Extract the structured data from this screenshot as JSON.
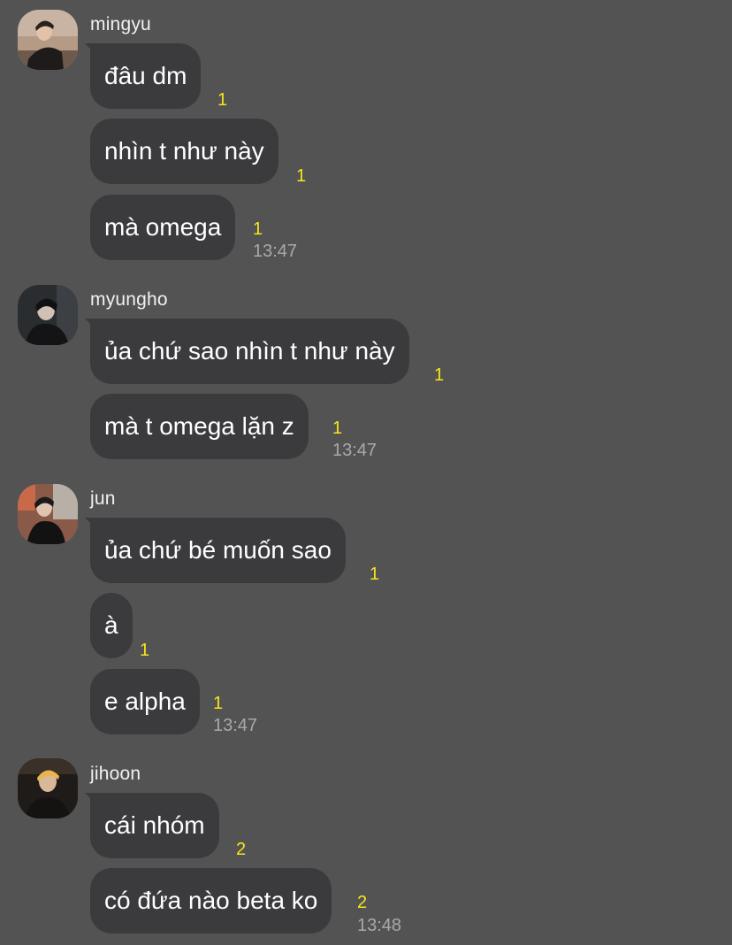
{
  "colors": {
    "background": "#545354",
    "bubble": "#3b3a3d",
    "unread_count": "#f7e51a",
    "timestamp": "#a9a8aa"
  },
  "groups": [
    {
      "sender": "mingyu",
      "avatar_icon": "profile-photo",
      "messages": [
        {
          "text": "đâu dm",
          "unread": "1"
        },
        {
          "text": "nhìn t như này",
          "unread": "1"
        },
        {
          "text": "mà omega",
          "unread": "1"
        }
      ],
      "time": "13:47"
    },
    {
      "sender": "myungho",
      "avatar_icon": "profile-photo",
      "messages": [
        {
          "text": "ủa chứ sao nhìn t như này",
          "unread": "1"
        },
        {
          "text": "mà t omega lặn z",
          "unread": "1"
        }
      ],
      "time": "13:47"
    },
    {
      "sender": "jun",
      "avatar_icon": "profile-photo",
      "messages": [
        {
          "text": "ủa chứ bé muốn sao",
          "unread": "1"
        },
        {
          "text": "à",
          "unread": "1"
        },
        {
          "text": "e alpha",
          "unread": "1"
        }
      ],
      "time": "13:47"
    },
    {
      "sender": "jihoon",
      "avatar_icon": "profile-photo",
      "messages": [
        {
          "text": "cái nhóm",
          "unread": "2"
        },
        {
          "text": "có đứa nào beta ko",
          "unread": "2"
        }
      ],
      "time": "13:48"
    }
  ]
}
